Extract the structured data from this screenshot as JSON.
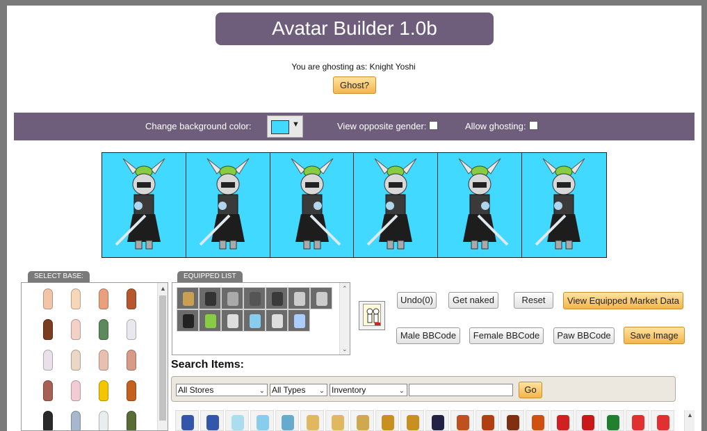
{
  "header": {
    "title": "Avatar Builder 1.0b",
    "ghost_status": "You are ghosting as: Knight Yoshi",
    "ghost_button": "Ghost?"
  },
  "options": {
    "bg_color_label": "Change background color:",
    "bg_color_value": "#41d9ff",
    "opposite_gender_label": "View opposite gender:",
    "opposite_gender_checked": false,
    "allow_ghosting_label": "Allow ghosting:",
    "allow_ghosting_checked": false
  },
  "avatar_previews": [
    {
      "pose": "front"
    },
    {
      "pose": "front-left"
    },
    {
      "pose": "side-left"
    },
    {
      "pose": "back"
    },
    {
      "pose": "side-right"
    },
    {
      "pose": "front-right"
    }
  ],
  "base_panel": {
    "tab": "SELECT BASE:",
    "bases": [
      {
        "color": "#f2c5a8"
      },
      {
        "color": "#f6d7ba"
      },
      {
        "color": "#e8a17c"
      },
      {
        "color": "#b5582e"
      },
      {
        "color": "#7a3d22"
      },
      {
        "color": "#f3d1c6"
      },
      {
        "color": "#5d8a5c"
      },
      {
        "color": "#e8e8ee"
      },
      {
        "color": "#e9e0ea"
      },
      {
        "color": "#ead7c5"
      },
      {
        "color": "#e7c0b0"
      },
      {
        "color": "#d79b88"
      },
      {
        "color": "#a66054"
      },
      {
        "color": "#f2ccd4"
      },
      {
        "color": "#f4c500"
      },
      {
        "color": "#c4611f"
      },
      {
        "color": "#2a2a2a"
      },
      {
        "color": "#a8b8cc"
      },
      {
        "color": "#e8eef0"
      },
      {
        "color": "#586c38"
      }
    ]
  },
  "equipped_panel": {
    "tab": "EQUIPPED LIST",
    "items": [
      {
        "icon": "necklace-icon",
        "color": "#c8a050"
      },
      {
        "icon": "pants-icon",
        "color": "#333333"
      },
      {
        "icon": "wing-helmet-icon",
        "color": "#aaaaaa"
      },
      {
        "icon": "visor-icon",
        "color": "#555555"
      },
      {
        "icon": "armor-icon",
        "color": "#3a3a3a"
      },
      {
        "icon": "shoulder-icon",
        "color": "#cccccc"
      },
      {
        "icon": "gauntlet-icon",
        "color": "#cccccc"
      },
      {
        "icon": "cape-icon",
        "color": "#222222"
      },
      {
        "icon": "frog-hat-icon",
        "color": "#88cc44"
      },
      {
        "icon": "wings-icon",
        "color": "#dddddd"
      },
      {
        "icon": "sword-icon",
        "color": "#88ccee"
      },
      {
        "icon": "boots-icon",
        "color": "#dddddd"
      },
      {
        "icon": "aura-icon",
        "color": "#aaccff"
      }
    ]
  },
  "buttons": {
    "undo": "Undo(0)",
    "get_naked": "Get naked",
    "reset": "Reset",
    "market_data": "View Equipped Market Data",
    "male_bbcode": "Male BBCode",
    "female_bbcode": "Female BBCode",
    "paw_bbcode": "Paw BBCode",
    "save_image": "Save Image"
  },
  "search": {
    "title": "Search Items:",
    "store_select": "All Stores",
    "type_select": "All Types",
    "source_select": "Inventory",
    "query": "",
    "go_button": "Go"
  },
  "results": [
    {
      "icon": "medal-icon",
      "color": "#3355aa"
    },
    {
      "icon": "medal-icon",
      "color": "#3355aa"
    },
    {
      "icon": "wings-icon",
      "color": "#aaddee"
    },
    {
      "icon": "ribbon-icon",
      "color": "#88ccee"
    },
    {
      "icon": "ribbon-icon",
      "color": "#66aacc"
    },
    {
      "icon": "necklace-icon",
      "color": "#e0b860"
    },
    {
      "icon": "necklace-icon",
      "color": "#e0b860"
    },
    {
      "icon": "necklace-icon",
      "color": "#d0a850"
    },
    {
      "icon": "bracelet-icon",
      "color": "#c89020"
    },
    {
      "icon": "bracelet-icon",
      "color": "#c89020"
    },
    {
      "icon": "glasses-icon",
      "color": "#222244"
    },
    {
      "icon": "pants-icon",
      "color": "#c05020"
    },
    {
      "icon": "boots-icon",
      "color": "#b04010"
    },
    {
      "icon": "cape-icon",
      "color": "#803010"
    },
    {
      "icon": "hat-icon",
      "color": "#d05010"
    },
    {
      "icon": "shoes-icon",
      "color": "#d02020"
    },
    {
      "icon": "hat-icon",
      "color": "#c81818"
    },
    {
      "icon": "wreath-icon",
      "color": "#208030"
    },
    {
      "icon": "candy-cane-icon",
      "color": "#e03030"
    },
    {
      "icon": "candy-cane-icon",
      "color": "#e03030"
    }
  ]
}
